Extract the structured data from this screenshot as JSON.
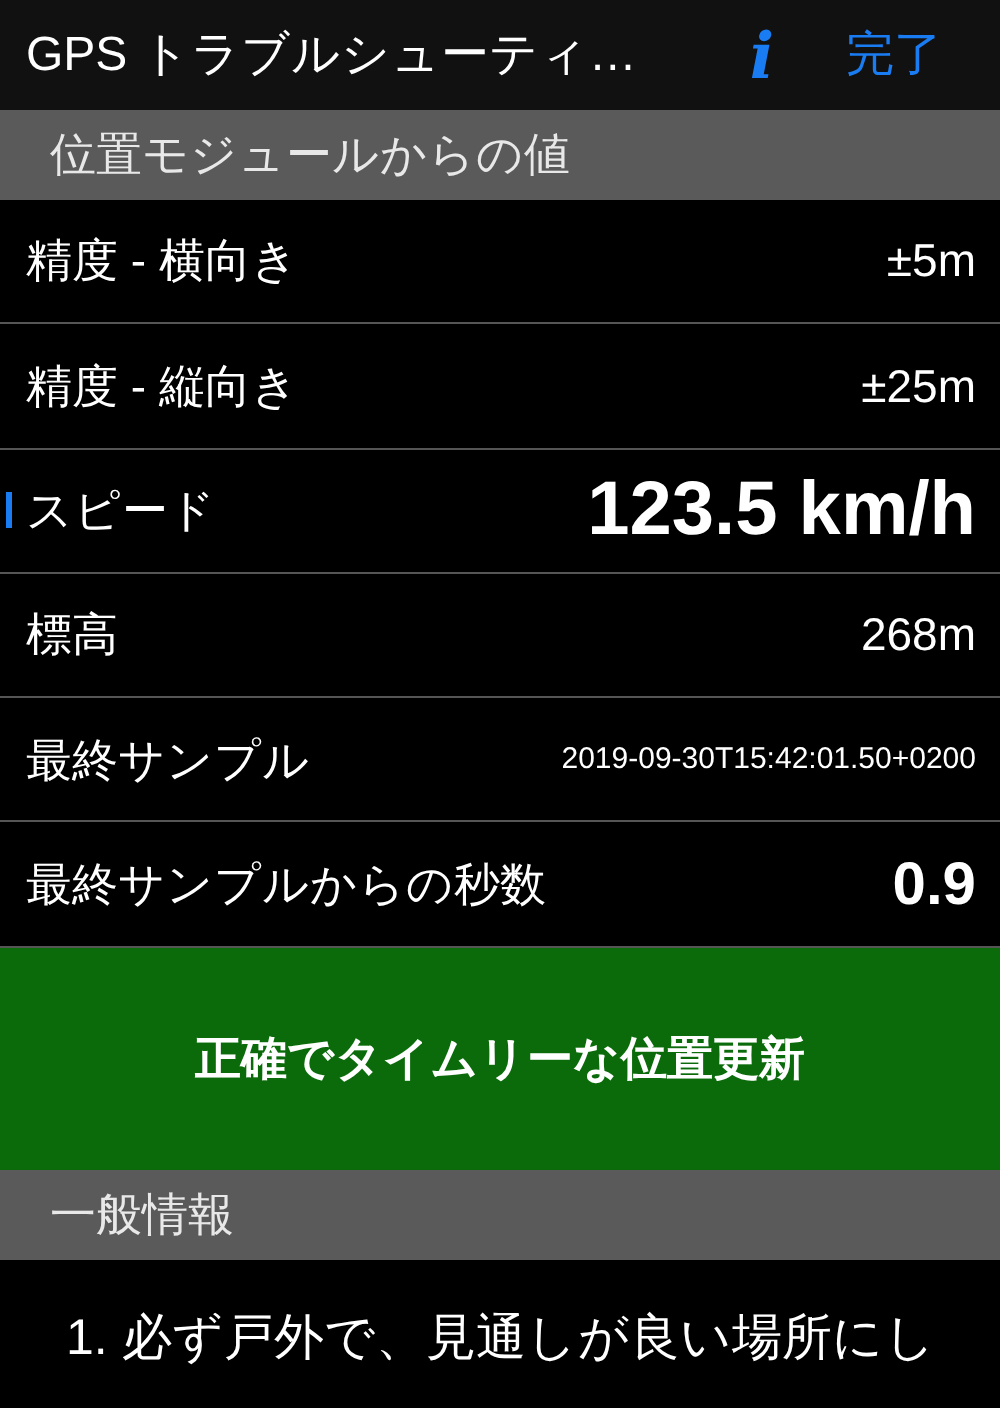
{
  "nav_bar": {
    "title": "GPS トラブルシューティ…",
    "info_button": "i",
    "done_button": "完了"
  },
  "sections": [
    {
      "header": "位置モジュールからの値",
      "rows": [
        {
          "label": "精度 - 横向き",
          "value": "±5m",
          "kind": "plain",
          "highlighted": false
        },
        {
          "label": "精度 - 縦向き",
          "value": "±25m",
          "kind": "plain",
          "highlighted": false
        },
        {
          "label": "スピード",
          "value": "123.5 km/h",
          "kind": "large",
          "highlighted": true
        },
        {
          "label": "標高",
          "value": "268m",
          "kind": "plain",
          "highlighted": false
        },
        {
          "label": "最終サンプル",
          "value": "2019-09-30T15:42:01.50+0200",
          "kind": "small",
          "highlighted": false
        },
        {
          "label": "最終サンプルからの秒数",
          "value": "0.9",
          "kind": "bold",
          "highlighted": false
        }
      ],
      "status_banner": {
        "text": "正確でタイムリーな位置更新",
        "color": "#0b6b0b"
      }
    },
    {
      "header": "一般情報",
      "paragraph": "1. 必ず戸外で、見通しが良い場所にし"
    }
  ]
}
